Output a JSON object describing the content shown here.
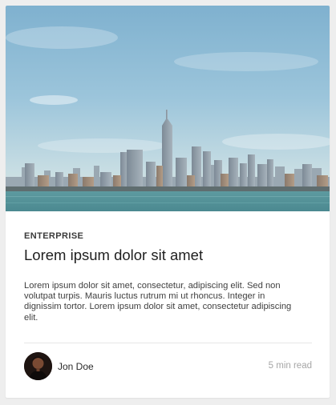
{
  "card": {
    "image": {
      "name": "city-skyline-photo"
    },
    "category": "ENTERPRISE",
    "title": "Lorem ipsum dolor sit amet",
    "excerpt": "Lorem ipsum dolor sit amet, consectetur, adipiscing elit. Sed non volutpat turpis.  Mauris luctus rutrum mi ut rhoncus. Integer in dignissim tortor. Lorem  ipsum dolor sit amet, consectetur adipiscing elit.",
    "author": {
      "name": "Jon Doe",
      "avatar": "author-avatar-photo"
    },
    "read_time": "5 min read"
  },
  "colors": {
    "page_background": "#eeeeee",
    "card_background": "#ffffff",
    "divider": "#e6e6e6",
    "muted_text": "#a6a6a6"
  }
}
